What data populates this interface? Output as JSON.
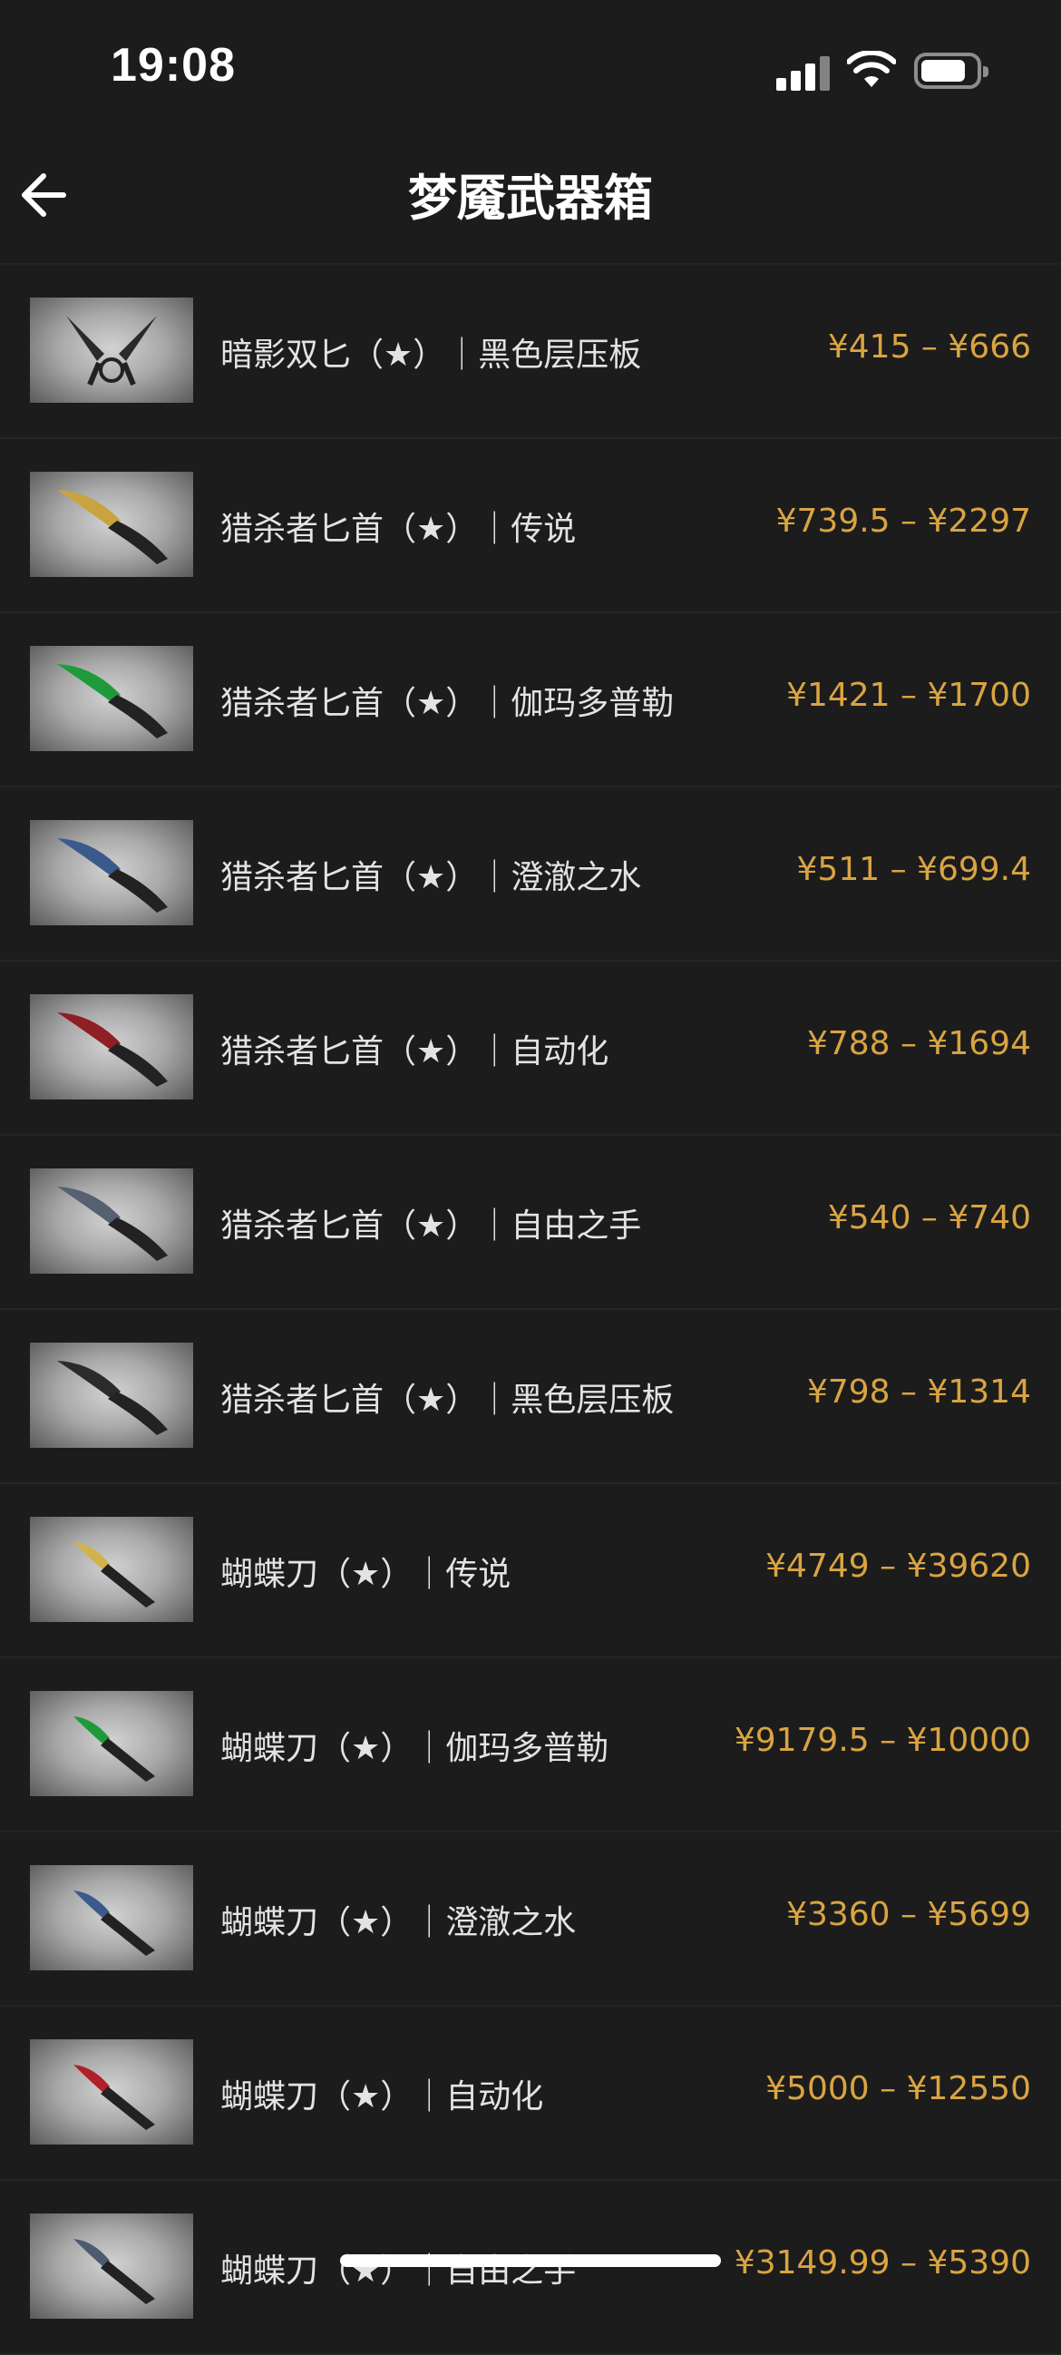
{
  "status": {
    "time": "19:08"
  },
  "header": {
    "title": "梦魇武器箱"
  },
  "items": [
    {
      "name": "暗影双匕（★）｜黑色层压板",
      "price": "¥415 – ¥666",
      "blade_color": "#2a2a2a"
    },
    {
      "name": "猎杀者匕首（★）｜传说",
      "price": "¥739.5 – ¥2297",
      "blade_color": "#c9a340"
    },
    {
      "name": "猎杀者匕首（★）｜伽玛多普勒",
      "price": "¥1421 – ¥1700",
      "blade_color": "#1f9a3a"
    },
    {
      "name": "猎杀者匕首（★）｜澄澈之水",
      "price": "¥511 – ¥699.4",
      "blade_color": "#3b5a8c"
    },
    {
      "name": "猎杀者匕首（★）｜自动化",
      "price": "¥788 – ¥1694",
      "blade_color": "#8e1f24"
    },
    {
      "name": "猎杀者匕首（★）｜自由之手",
      "price": "¥540 – ¥740",
      "blade_color": "#556070"
    },
    {
      "name": "猎杀者匕首（★）｜黑色层压板",
      "price": "¥798 – ¥1314",
      "blade_color": "#2b2b2b"
    },
    {
      "name": "蝴蝶刀（★）｜传说",
      "price": "¥4749 – ¥39620",
      "blade_color": "#d2b24a"
    },
    {
      "name": "蝴蝶刀（★）｜伽玛多普勒",
      "price": "¥9179.5 – ¥10000",
      "blade_color": "#1f9a3a"
    },
    {
      "name": "蝴蝶刀（★）｜澄澈之水",
      "price": "¥3360 – ¥5699",
      "blade_color": "#3b5a8c"
    },
    {
      "name": "蝴蝶刀（★）｜自动化",
      "price": "¥5000 – ¥12550",
      "blade_color": "#b21f2a"
    },
    {
      "name": "蝴蝶刀（★）｜自由之手",
      "price": "¥3149.99 – ¥5390",
      "blade_color": "#4d5a70"
    }
  ],
  "icons": {
    "back": "arrow-left-icon",
    "signal": "cellular-signal-icon",
    "wifi": "wifi-icon",
    "battery": "battery-icon"
  },
  "colors": {
    "background": "#1c1c1d",
    "price": "#d9a441",
    "text": "#e3e3e4"
  }
}
